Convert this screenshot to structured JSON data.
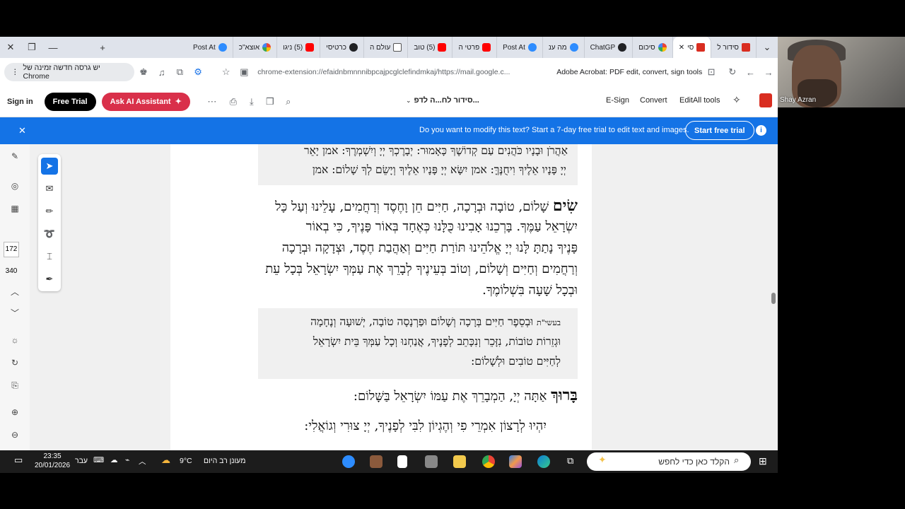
{
  "tabs": [
    {
      "label": "סידור ל",
      "icon": "pdf"
    },
    {
      "label": "סי",
      "icon": "pdf",
      "active": true
    },
    {
      "label": "סיכום",
      "icon": "google"
    },
    {
      "label": "ChatGP",
      "icon": "chatgpt"
    },
    {
      "label": "מה ענ",
      "icon": "zoom"
    },
    {
      "label": "Post At",
      "icon": "zoom"
    },
    {
      "label": "פרטי ה",
      "icon": "youtube"
    },
    {
      "label": "(5) טוב",
      "icon": "youtube"
    },
    {
      "label": "עולם ה",
      "icon": "doc"
    },
    {
      "label": "כרטיסי",
      "icon": "github"
    },
    {
      "label": "(5) ניגו",
      "icon": "youtube"
    },
    {
      "label": "אוצא\"כ",
      "icon": "google"
    },
    {
      "label": "Post At",
      "icon": "zoom"
    }
  ],
  "address": {
    "update_notice": "יש גרסה חדשה זמינה של Chrome",
    "url": "chrome-extension://efaidnbmnnnibpcajpcglclefindmkaj/https://mail.google.c...",
    "extension_name": "Adobe Acrobat: PDF edit, convert, sign tools"
  },
  "acrobat": {
    "sign_in": "Sign in",
    "free_trial": "Free Trial",
    "ask_ai": "Ask AI Assistant",
    "doc_title": "סידור לח...ה לדפ...",
    "esign": "E-Sign",
    "convert": "Convert",
    "edit_all": "EditAll tools"
  },
  "banner": {
    "text": "Do you want to modify this text? Start a 7-day free trial to edit text and images.",
    "button": "Start free trial"
  },
  "nav": {
    "current_page": "172",
    "total_pages": "340"
  },
  "document": {
    "box1_line1": "אַהֲרֹן וּבָנָיו כֹּהֲנִים עַם קְדוֹשֶׁךָ כָּאָמוּר: יְבָרֶכְךָ יְיָ וְיִשְׁמְרֶךָ: אמן יָאֵר",
    "box1_line2": "יְיָ פָּנָיו אֵלֶיךָ וִיחֻנֶּךָּ: אמן יִשָּׂא יְיָ פָּנָיו אֵלֶיךָ וְיָשֵׂם לְךָ שָׁלוֹם: אמן",
    "sim_word": "שִׂים",
    "p1_line1": "שָׁלוֹם, טוֹבָה וּבְרָכָה, חַיִּים חֵן וָחֶסֶד וְרַחֲמִים, עָלֵינוּ וְעַל כָּל",
    "p1_line2": "יִשְׂרָאֵל עַמֶּךָ. בָּרְכֵנוּ אָבִינוּ כֻּלָּנוּ כְּאֶחָד בְּאוֹר פָּנֶיךָ, כִּי בְאוֹר",
    "p1_line3": "פָּנֶיךָ נָתַתָּ לָּנוּ יְיָ אֱלֹהֵינוּ תּוֹרַת חַיִּים וְאַהֲבַת חֶסֶד, וּצְדָקָה וּבְרָכָה",
    "p1_line4": "וְרַחֲמִים וְחַיִּים וְשָׁלוֹם, וְטוֹב בְּעֵינֶיךָ לְבָרֵךְ אֶת עַמְּךָ יִשְׂרָאֵל בְּכָל עֵת",
    "p1_line5": "וּבְכָל שָׁעָה בִּשְׁלוֹמֶךָ.",
    "box2_prefix": "בעשי\"ת",
    "box2_line1": "וּבְסֵפֶר חַיִּים בְּרָכָה וְשָׁלוֹם וּפַרְנָסָה טוֹבָה, יְשׁוּעָה וְנֶחָמָה",
    "box2_line2": "וּגְזֵרוֹת טוֹבוֹת, נִזָּכֵר וְנִכָּתֵב לְפָנֶיךָ, אֲנַחְנוּ וְכָל עַמְּךָ בֵּית יִשְׂרָאֵל",
    "box2_line3": "לְחַיִּים טוֹבִים וּלְשָׁלוֹם:",
    "baruch_word": "בָּרוּךְ",
    "baruch_rest": "אַתָּה יְיָ, הַמְבָרֵךְ אֶת עַמּוֹ יִשְׂרָאֵל בַּשָּׁלוֹם:",
    "yihyu": "יִהְיוּ לְרָצוֹן אִמְרֵי פִי וְהֶגְיוֹן לִבִּי לְפָנֶיךָ, יְיָ צוּרִי וְגוֹאֲלִי:"
  },
  "webcam": {
    "name": "Shay Azran"
  },
  "taskbar": {
    "search_placeholder": "הקלד כאן כדי לחפש",
    "weather_temp": "9°C",
    "weather_text": "מעונן רב היום",
    "language": "עבר",
    "time": "23:35",
    "date": "20/01/2026"
  }
}
